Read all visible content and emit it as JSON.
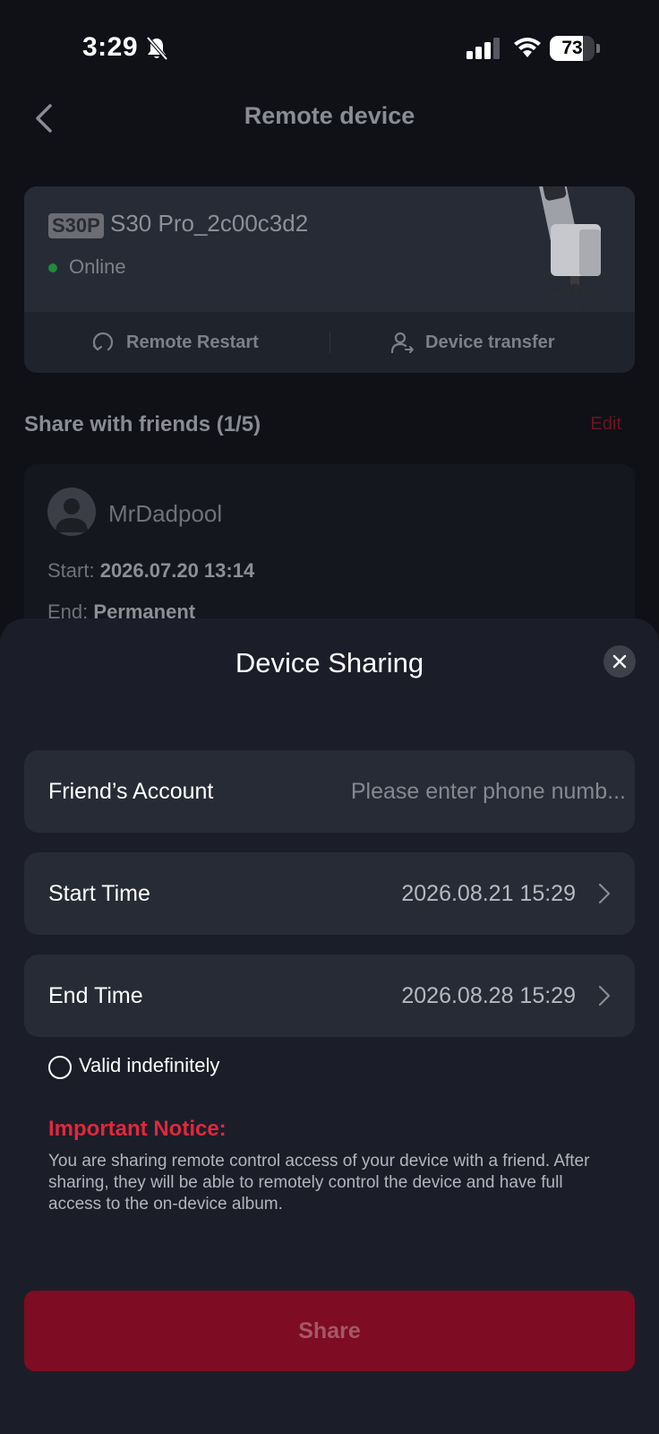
{
  "status_bar": {
    "time": "3:29",
    "battery_percent": 73,
    "battery_label": "73"
  },
  "nav": {
    "title": "Remote device",
    "back_icon": "chevron-left-icon"
  },
  "device": {
    "model_badge": "S30P",
    "name": "S30 Pro_2c00c3d2",
    "status": "Online",
    "status_color": "#1f8a3a",
    "actions": {
      "remote_restart": "Remote Restart",
      "device_transfer": "Device transfer"
    }
  },
  "share_section": {
    "title": "Share with friends (1/5)",
    "edit_label": "Edit",
    "friend": {
      "name": "MrDadpool",
      "start_label": "Start:",
      "start_value": "2026.07.20 13:14",
      "end_label": "End:",
      "end_value": "Permanent"
    }
  },
  "sheet": {
    "title": "Device Sharing",
    "account_label": "Friend’s Account",
    "account_placeholder": "Please enter phone numb...",
    "account_value": "",
    "start_label": "Start Time",
    "start_value": "2026.08.21 15:29",
    "end_label": "End Time",
    "end_value": "2026.08.28 15:29",
    "valid_indefinitely_label": "Valid indefinitely",
    "valid_indefinitely_checked": false,
    "notice_title": "Important Notice:",
    "notice_text": "You are sharing remote control access of your device with a friend. After sharing, they will be able to remotely control the device and have full access to the on-device album.",
    "share_button": "Share"
  },
  "colors": {
    "background": "#0f1117",
    "sheet": "#1b1e28",
    "field": "#272b35",
    "accent_red": "#e0283e",
    "share_button": "#7e0c22"
  }
}
